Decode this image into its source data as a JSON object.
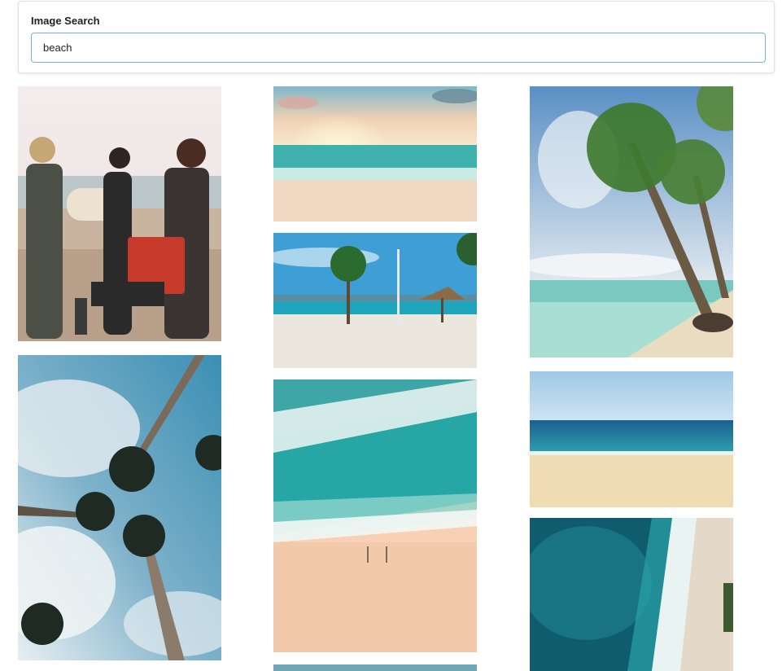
{
  "search": {
    "label": "Image Search",
    "value": "beach"
  },
  "results": [
    {
      "name": "people-grilling-on-beach"
    },
    {
      "name": "palm-trees-from-below"
    },
    {
      "name": "sunset-beach-waves"
    },
    {
      "name": "tropical-beach-umbrella-palm"
    },
    {
      "name": "aerial-waves-on-sand"
    },
    {
      "name": "palm-trees-turquoise-water"
    },
    {
      "name": "calm-sea-horizon"
    },
    {
      "name": "aerial-coastline-surf"
    },
    {
      "name": "partial-beach-photo"
    }
  ]
}
